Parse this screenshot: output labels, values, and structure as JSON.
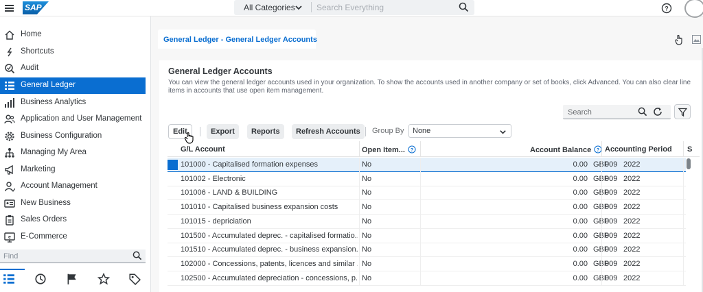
{
  "shell": {
    "logo_text": "SAP",
    "category": "All Categories",
    "search_placeholder": "Search Everything"
  },
  "sidebar": {
    "items": [
      {
        "label": "Home",
        "icon": "home-icon"
      },
      {
        "label": "Shortcuts",
        "icon": "shortcut-icon"
      },
      {
        "label": "Audit",
        "icon": "audit-icon"
      },
      {
        "label": "General Ledger",
        "icon": "list-icon",
        "active": true
      },
      {
        "label": "Business Analytics",
        "icon": "bar-chart-icon"
      },
      {
        "label": "Application and User Management",
        "icon": "users-icon"
      },
      {
        "label": "Business Configuration",
        "icon": "gear-icon"
      },
      {
        "label": "Managing My Area",
        "icon": "org-icon"
      },
      {
        "label": "Marketing",
        "icon": "megaphone-icon"
      },
      {
        "label": "Account Management",
        "icon": "account-icon"
      },
      {
        "label": "New Business",
        "icon": "card-icon"
      },
      {
        "label": "Sales Orders",
        "icon": "clipboard-icon"
      },
      {
        "label": "E-Commerce",
        "icon": "ecommerce-icon"
      }
    ],
    "find_placeholder": "Find",
    "bottom_tabs": [
      "list-icon",
      "history-icon",
      "flag-icon",
      "favorite-icon",
      "tag-icon"
    ]
  },
  "tab": {
    "title": "General Ledger - General Ledger Accounts"
  },
  "panel": {
    "title": "General Ledger Accounts",
    "description": "You can view the general ledger accounts used in your organization. To show the accounts used in another company or set of books, click Advanced. You can also clear line items in accounts that use open item management.",
    "search_placeholder": "Search"
  },
  "toolbar": {
    "edit": "Edit",
    "export": "Export",
    "reports": "Reports",
    "refresh": "Refresh Accounts",
    "group_by_label": "Group By",
    "group_by_value": "None"
  },
  "table": {
    "headers": {
      "account": "G/L Account",
      "open_item": "Open Item...",
      "balance": "Account Balance",
      "period": "Accounting Period",
      "extra": "S"
    },
    "rows": [
      {
        "account": "101000 - Capitalised formation expenses",
        "open": "No",
        "amount": "0.00",
        "currency": "GBP",
        "period": "009",
        "year": "2022"
      },
      {
        "account": "101002 - Electronic",
        "open": "No",
        "amount": "0.00",
        "currency": "GBP",
        "period": "009",
        "year": "2022"
      },
      {
        "account": "101006 - LAND & BUILDING",
        "open": "No",
        "amount": "0.00",
        "currency": "GBP",
        "period": "009",
        "year": "2022"
      },
      {
        "account": "101010 - Capitalised business expansion costs",
        "open": "No",
        "amount": "0.00",
        "currency": "GBP",
        "period": "009",
        "year": "2022"
      },
      {
        "account": "101015 - depriciation",
        "open": "No",
        "amount": "0.00",
        "currency": "GBP",
        "period": "009",
        "year": "2022"
      },
      {
        "account": "101500 - Accumulated deprec. - capitalised formatio...",
        "open": "No",
        "amount": "0.00",
        "currency": "GBP",
        "period": "009",
        "year": "2022"
      },
      {
        "account": "101510 - Accumulated deprec. - business expansion...",
        "open": "No",
        "amount": "0.00",
        "currency": "GBP",
        "period": "009",
        "year": "2022"
      },
      {
        "account": "102000 - Concessions, patents, licences and similar ...",
        "open": "No",
        "amount": "0.00",
        "currency": "GBP",
        "period": "009",
        "year": "2022"
      },
      {
        "account": "102500 - Accumulated depreciation - concessions, p...",
        "open": "No",
        "amount": "0.00",
        "currency": "GBP",
        "period": "009",
        "year": "2022"
      }
    ]
  },
  "colors": {
    "accent": "#0a6ed1",
    "selected_row": "#e5f0fa"
  }
}
